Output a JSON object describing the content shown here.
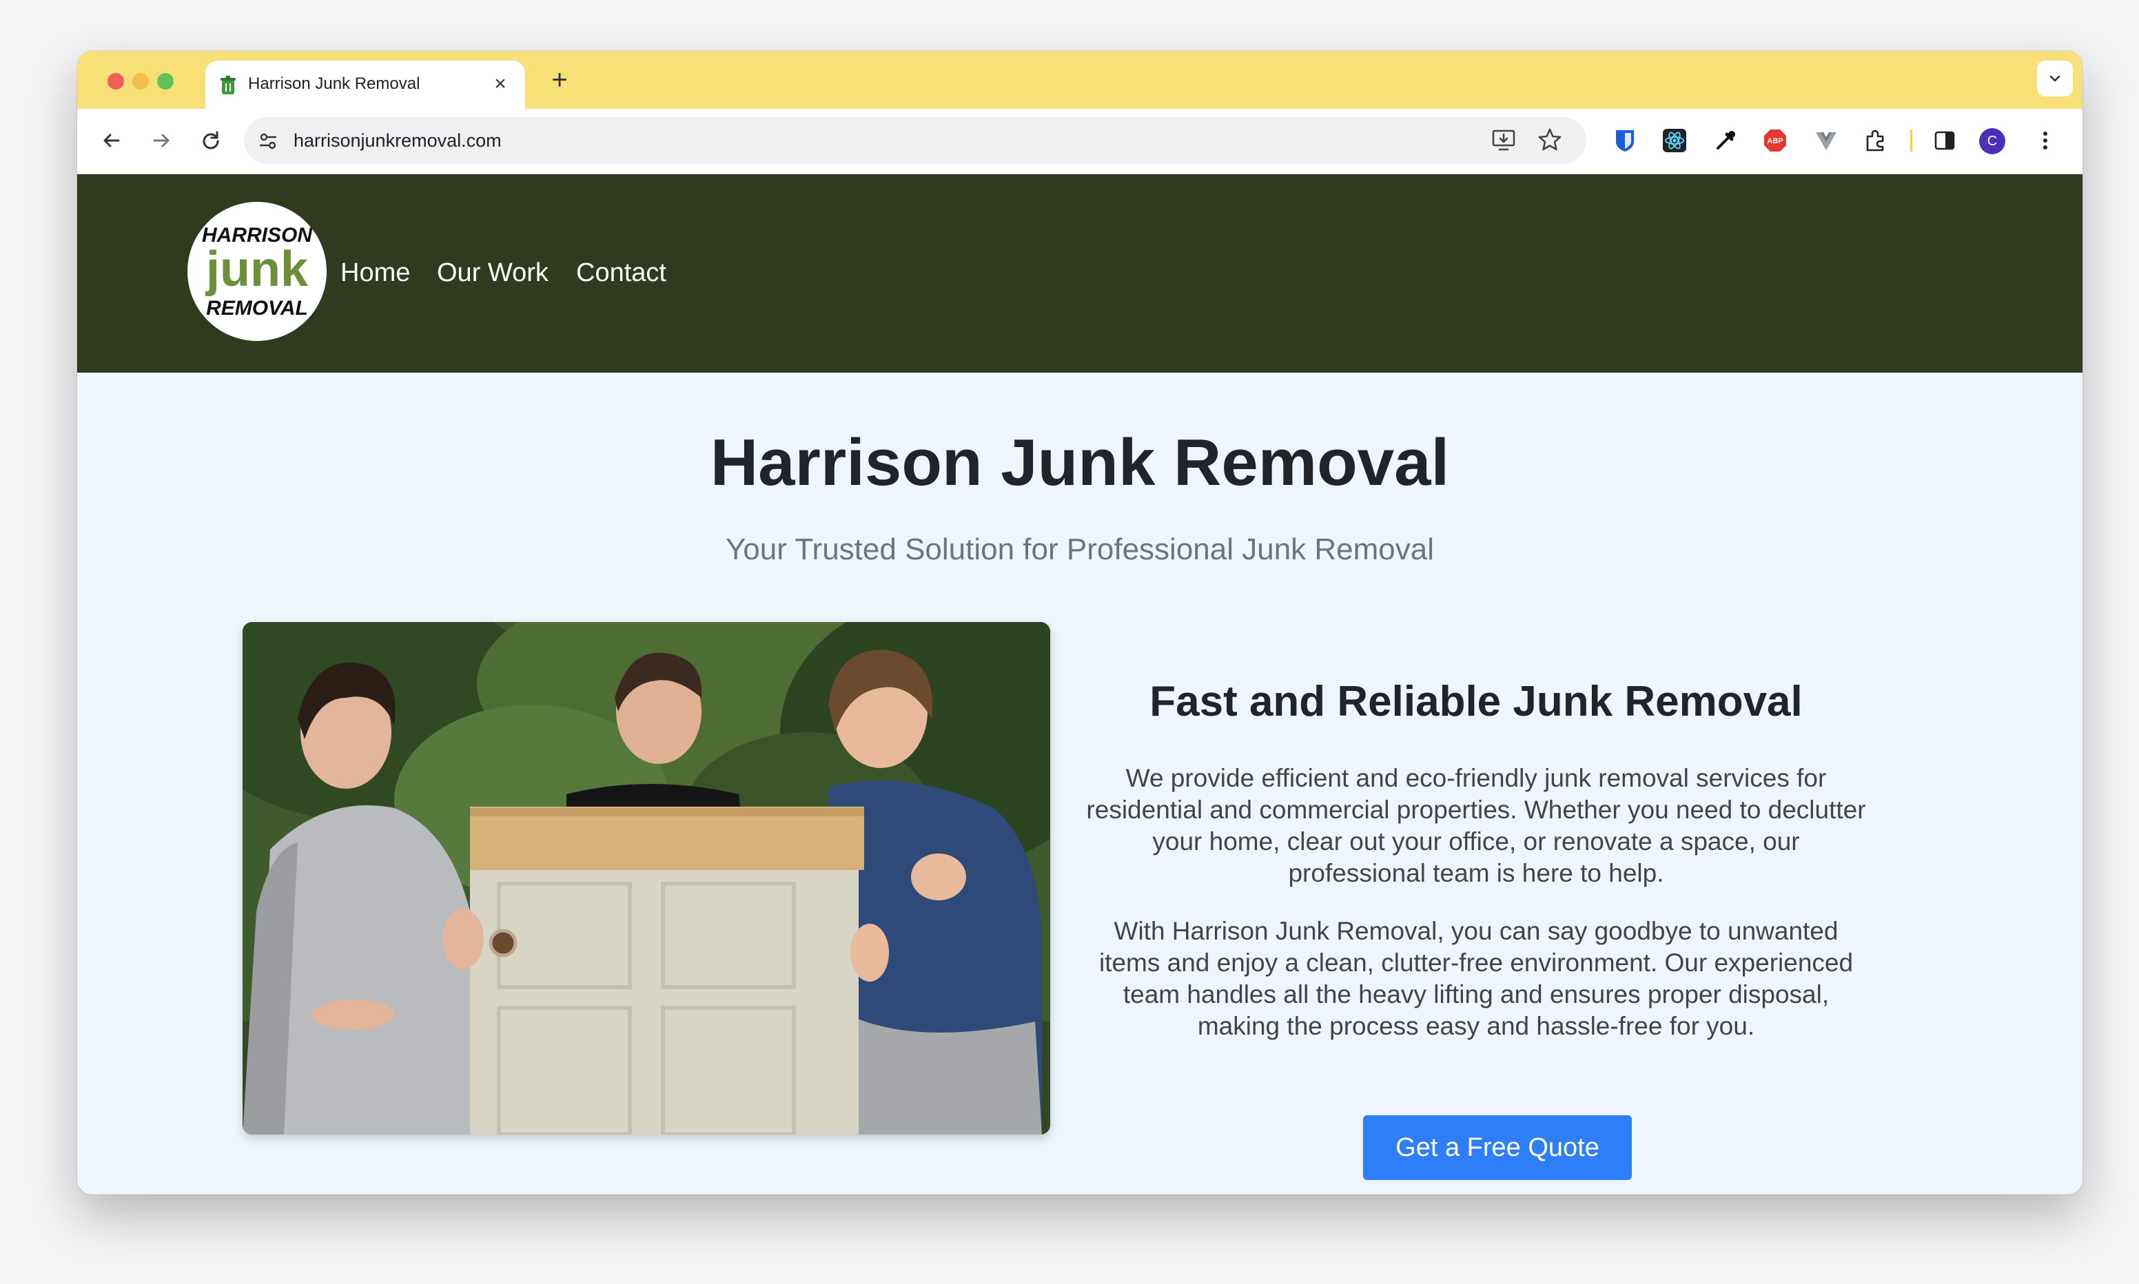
{
  "browser": {
    "tab": {
      "title": "Harrison Junk Removal",
      "close_glyph": "×",
      "favicon": "trash-can-icon"
    },
    "new_tab_glyph": "+",
    "address": {
      "url": "harrisonjunkremoval.com"
    },
    "profile_initial": "C",
    "extensions": [
      "bitwarden-icon",
      "react-devtools-icon",
      "eyedropper-icon",
      "adblock-plus-icon",
      "vue-devtools-icon",
      "puzzle-extensions-icon"
    ],
    "adblock_label": "ABP"
  },
  "site": {
    "logo": {
      "line1": "HARRISON",
      "line2": "junk",
      "line3": "REMOVAL"
    },
    "nav": [
      {
        "label": "Home"
      },
      {
        "label": "Our Work"
      },
      {
        "label": "Contact"
      }
    ],
    "hero": {
      "title": "Harrison Junk Removal",
      "subtitle": "Your Trusted Solution for Professional Junk Removal"
    },
    "content": {
      "title": "Fast and Reliable Junk Removal",
      "paragraph_1": "We provide efficient and eco-friendly junk removal services for residential and commercial properties. Whether you need to declutter your home, clear out your office, or renovate a space, our professional team is here to help.",
      "paragraph_2": "With Harrison Junk Removal, you can say goodbye to unwanted items and enjoy a clean, clutter-free environment. Our experienced team handles all the heavy lifting and ensures proper disposal, making the process easy and hassle-free for you.",
      "cta_label": "Get a Free Quote"
    }
  },
  "colors": {
    "tab_strip": "#f9df77",
    "site_header": "#2f3a1e",
    "page_background": "#eef5fd",
    "cta": "#2d7ef7",
    "logo_green": "#6b8f3a"
  }
}
